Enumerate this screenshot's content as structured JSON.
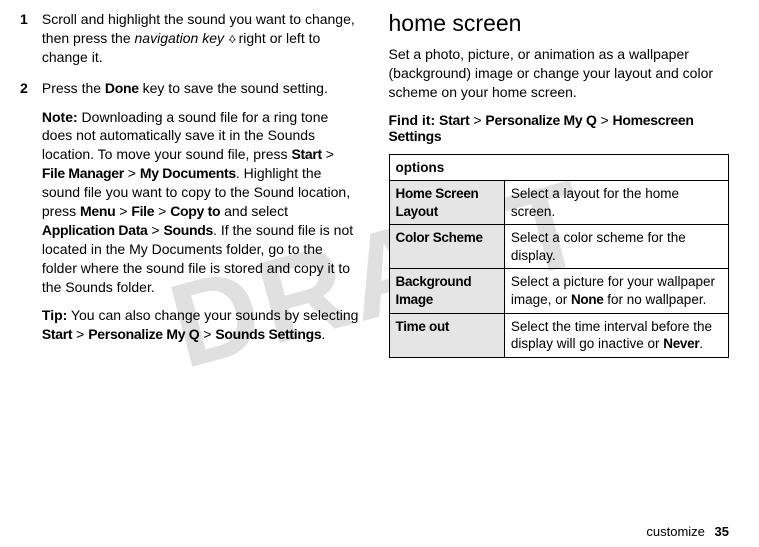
{
  "watermark": "DRAFT",
  "left": {
    "step1": {
      "num": "1",
      "t1": "Scroll and highlight the sound you want to change, then press the ",
      "navkey": "navigation key",
      "glyph": "·◊·",
      "t2": " right or left to change it."
    },
    "step2": {
      "num": "2",
      "t1": "Press the ",
      "done": "Done",
      "t2": " key to save the sound setting.",
      "noteLabel": "Note:",
      "noteText1": " Downloading a sound file for a ring tone does not automatically save it in the Sounds location. To move your sound file, press ",
      "start": "Start",
      "gt1": " > ",
      "fileManager": "File Manager",
      "gt2": " > ",
      "myDocs": "My Documents",
      "noteText2": ". Highlight the sound file you want to copy to the Sound location, press ",
      "menu": "Menu",
      "gt3": " > ",
      "file": "File",
      "gt4": " > ",
      "copyTo": "Copy to",
      "noteText3": " and select ",
      "appData": "Application Data",
      "gt5": " > ",
      "sounds": "Sounds",
      "noteText4": ". If the sound file is not located in the My Documents folder, go to the folder where the sound file is stored and copy it to the Sounds folder.",
      "tipLabel": "Tip:",
      "tipText1": " You can also change your sounds by selecting ",
      "start2": "Start",
      "gt6": " > ",
      "personalize": "Personalize My Q",
      "gt7": " > ",
      "soundsSettings": "Sounds Settings",
      "tipText2": "."
    }
  },
  "right": {
    "heading": "home screen",
    "intro": "Set a photo, picture, or animation as a wallpaper (background) image or change your layout and color scheme on your home screen.",
    "findLabel": "Find it:",
    "fStart": "Start",
    "fGt1": " > ",
    "fPersonalize": "Personalize My Q",
    "fGt2": " > ",
    "fHome": "Homescreen Settings",
    "optionsHeader": "options",
    "rows": [
      {
        "label": "Home Screen Layout",
        "desc1": "Select a layout for the home screen.",
        "none": "",
        "desc2": ""
      },
      {
        "label": "Color Scheme",
        "desc1": "Select a color scheme for the display.",
        "none": "",
        "desc2": ""
      },
      {
        "label": "Background Image",
        "desc1": "Select a picture for your wallpaper image, or ",
        "none": "None",
        "desc2": " for no wallpaper."
      },
      {
        "label": "Time out",
        "desc1": "Select the time interval before the display will go inactive or ",
        "none": "Never",
        "desc2": "."
      }
    ]
  },
  "footer": {
    "section": "customize",
    "page": "35"
  }
}
